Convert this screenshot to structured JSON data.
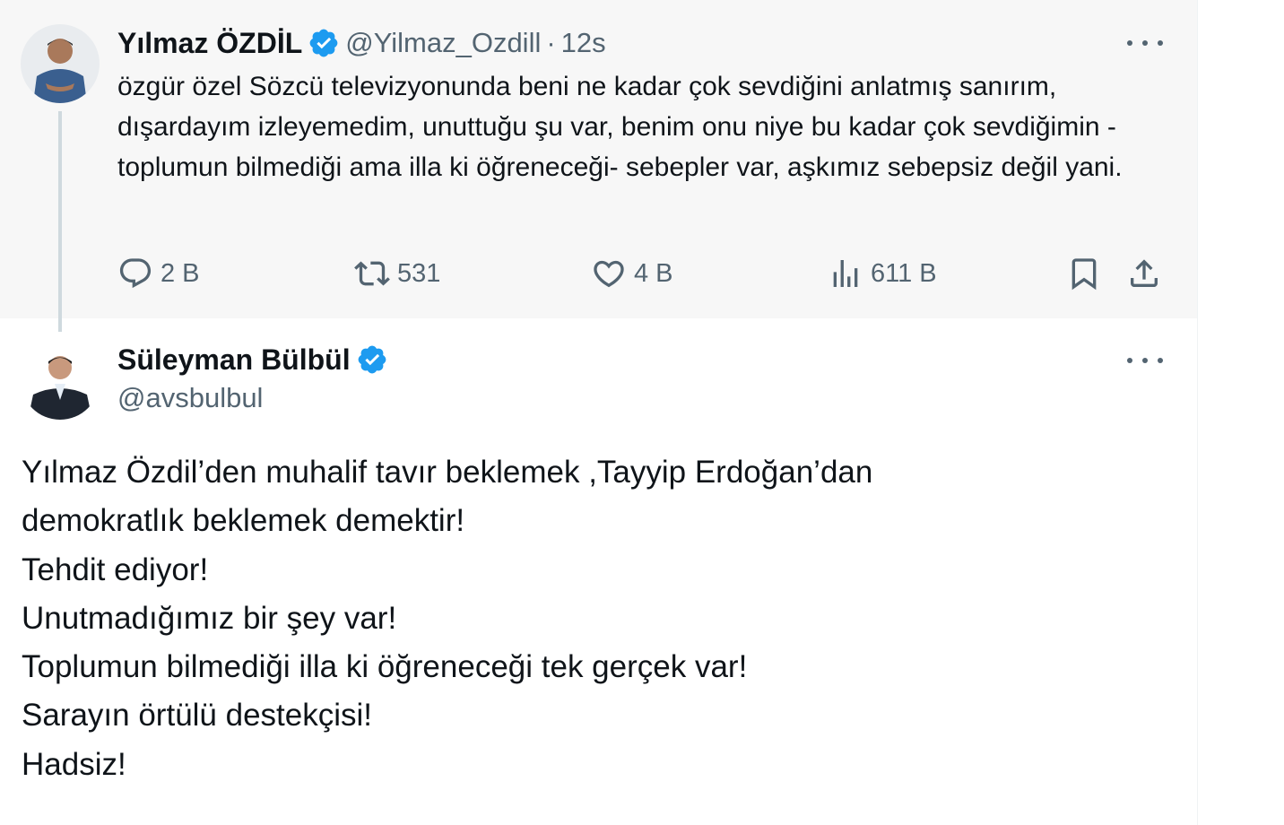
{
  "colors": {
    "text": "#0f1419",
    "secondary": "#536471",
    "verified": "#1d9bf0",
    "parent_bg": "#f7f7f7",
    "thread_line": "#cfd9de"
  },
  "parent_tweet": {
    "author_name": "Yılmaz ÖZDİL",
    "handle": "@Yilmaz_Ozdill",
    "separator": "·",
    "time": "12s",
    "text": "özgür özel Sözcü televizyonunda beni ne kadar çok sevdiğini anlatmış sanırım, dışardayım izleyemedim, unuttuğu şu var, benim onu niye bu kadar çok sevdiğimin -toplumun bilmediği ama illa ki öğreneceği- sebepler var, aşkımız sebepsiz değil yani.",
    "actions": {
      "replies": "2 B",
      "retweets": "531",
      "likes": "4 B",
      "views": "611 B"
    },
    "icons": [
      "reply-icon",
      "retweet-icon",
      "like-icon",
      "views-icon",
      "bookmark-icon",
      "share-icon",
      "more-icon",
      "verified-icon"
    ]
  },
  "reply_tweet": {
    "author_name": "Süleyman Bülbül",
    "handle": "@avsbulbul",
    "lines": [
      "Yılmaz Özdil’den  muhalif tavır beklemek ,Tayyip Erdoğan’dan",
      "demokratlık beklemek demektir!",
      "Tehdit ediyor!",
      "Unutmadığımız bir şey var!",
      "Toplumun bilmediği illa ki öğreneceği tek gerçek var!",
      "Sarayın örtülü destekçisi!",
      "Hadsiz!"
    ]
  }
}
